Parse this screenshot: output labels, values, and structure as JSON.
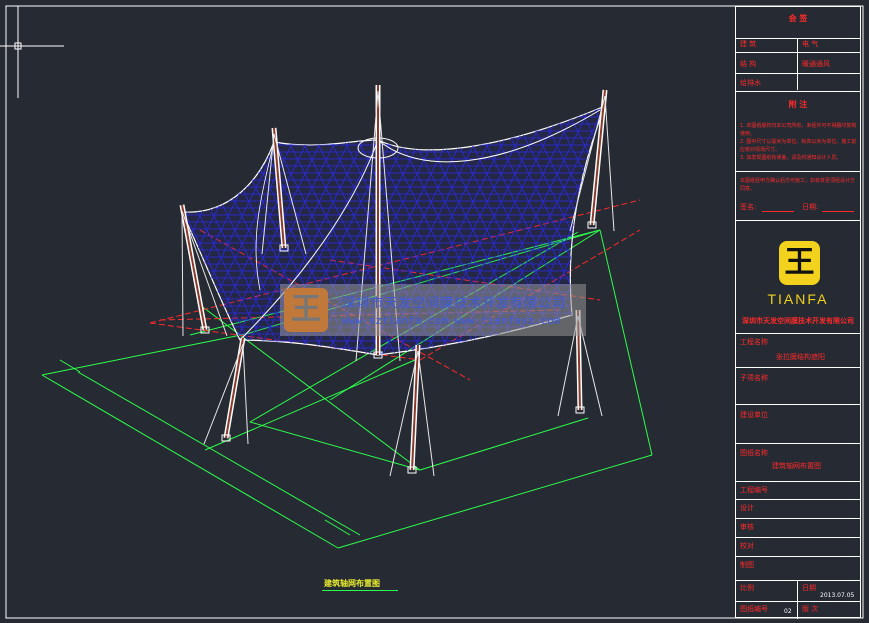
{
  "drawing": {
    "caption": "建筑轴网布置图"
  },
  "title_block": {
    "header": "会 签",
    "sign_rows": [
      {
        "left": "建 筑",
        "right": "电 气"
      },
      {
        "left": "结 构",
        "right": "暖通通风"
      },
      {
        "left": "给排水",
        "right": ""
      }
    ],
    "notes_title": "附 注",
    "notes": [
      "1. 本图纸版权归本公司所有，未经许可不得翻印复制使用。",
      "2. 图中尺寸以毫米为单位，标高以米为单位，施工前应核对现场尺寸。",
      "3. 如发现图纸有误差，请及时通知设计人员。"
    ],
    "confirm_text": "本图纸经甲方确认后方可施工，如有变更须经设计方同意。",
    "sign_label": "签名:",
    "date_label": "日期:",
    "logo_glyph": "王",
    "brand": "TIANFA",
    "company": "深圳市天发空间膜技术开发有限公司",
    "project_label": "工程名称",
    "project_value": "张拉膜结构遮阳",
    "sub_label": "子项名称",
    "unit_label": "建设单位",
    "drawing_name_label": "图纸名称",
    "drawing_name_value": "建筑轴网布置图",
    "fields": [
      "工程编号",
      "设计",
      "审核",
      "校对",
      "制图"
    ],
    "scale_label": "比例",
    "date_field_label": "日期",
    "date_value": "2013.07.05",
    "sheet_label": "图纸编号",
    "sheet_value": "02",
    "version_label": "版 次"
  },
  "watermark": {
    "logo_glyph": "王",
    "company": "深圳市天发空间膜技术开发有限公司",
    "url": "www.sztianfa.com   www.tianfasz.com"
  },
  "colors": {
    "background": "#262a33",
    "grid": "#2cff4a",
    "axis": "#ff2a2a",
    "membrane": "#2222ee",
    "mast": "#ffffff",
    "title_text": "#ff2a2a",
    "brand": "#f2d21c"
  }
}
